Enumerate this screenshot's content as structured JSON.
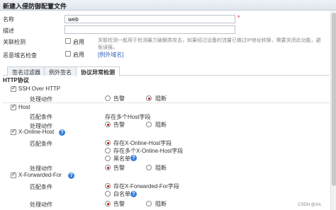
{
  "window": {
    "title": "新建入侵防御配置文件"
  },
  "form": {
    "name_label": "名称",
    "name_value": "web",
    "required_mark": "*",
    "desc_label": "描述",
    "desc_value": "",
    "correlation_label": "关联检测",
    "correlation_enable": "启用",
    "correlation_hint": "关联检测一般用于检测暴力破解类攻击，如果经过设备的流量已做过IP地址转换，需要关闭此功能，避免误报。",
    "malicious_label": "恶意域名检查",
    "malicious_enable": "启用",
    "malicious_link": "[例外域名]"
  },
  "tabs": [
    {
      "label": "签名过滤器",
      "active": false
    },
    {
      "label": "例外签名",
      "active": false
    },
    {
      "label": "协议异常检测",
      "active": true
    }
  ],
  "http": {
    "section_title": "HTTP协议",
    "ssh": {
      "label": "SSH Over HTTP",
      "action_label": "处理动作",
      "opt_alert": "告警",
      "opt_block": "阻断",
      "selected": "阻断"
    },
    "host": {
      "label": "Host",
      "match_label": "匹配条件",
      "match_value": "存在多个Host字段",
      "action_label": "处理动作",
      "opt_alert": "告警",
      "opt_block": "阻断",
      "selected": "告警"
    },
    "xonline": {
      "label": "X-Online-Host",
      "match_label": "匹配条件",
      "opt1": "存在X-Online-Host字段",
      "opt2": "存在多个X-Online-Host字段",
      "opt3": "黑名单",
      "action_label": "处理动作",
      "opt_alert": "告警",
      "opt_block": "阻断",
      "selected": "告警"
    },
    "xforward": {
      "label": "X-Forwarded-For",
      "match_label": "匹配条件",
      "opt1": "存在X-Forwarded-For字段",
      "opt2": "白名单",
      "action_label": "处理动作",
      "opt_alert": "告警",
      "opt_block": "阻断",
      "selected": "告警"
    },
    "help_glyph": "?"
  },
  "watermark": "CSDN @AA"
}
